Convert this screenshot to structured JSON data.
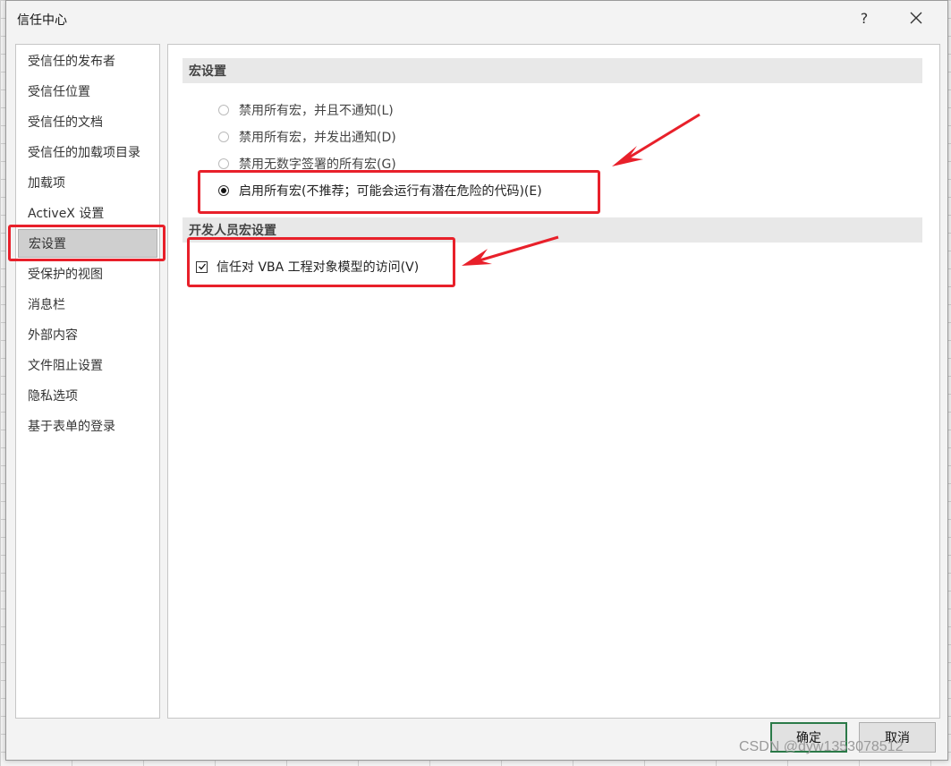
{
  "dialog": {
    "title": "信任中心",
    "help_label": "?"
  },
  "sidebar": {
    "items": [
      {
        "label": "受信任的发布者"
      },
      {
        "label": "受信任位置"
      },
      {
        "label": "受信任的文档"
      },
      {
        "label": "受信任的加载项目录"
      },
      {
        "label": "加载项"
      },
      {
        "label": "ActiveX 设置"
      },
      {
        "label": "宏设置"
      },
      {
        "label": "受保护的视图"
      },
      {
        "label": "消息栏"
      },
      {
        "label": "外部内容"
      },
      {
        "label": "文件阻止设置"
      },
      {
        "label": "隐私选项"
      },
      {
        "label": "基于表单的登录"
      }
    ],
    "selected": "宏设置"
  },
  "macro_settings": {
    "header": "宏设置",
    "options": [
      {
        "label": "禁用所有宏，并且不通知(L)",
        "checked": false
      },
      {
        "label": "禁用所有宏，并发出通知(D)",
        "checked": false
      },
      {
        "label": "禁用无数字签署的所有宏(G)",
        "checked": false
      },
      {
        "label": "启用所有宏(不推荐；可能会运行有潜在危险的代码)(E)",
        "checked": true
      }
    ]
  },
  "developer_settings": {
    "header": "开发人员宏设置",
    "trust_vba_label": "信任对 VBA 工程对象模型的访问(V)",
    "trust_vba_checked": true
  },
  "footer": {
    "ok_label": "确定",
    "cancel_label": "取消"
  },
  "watermark": "CSDN @dyw1353078512",
  "colors": {
    "annotation": "#e8202a",
    "default_button_border": "#2b7a48",
    "selected_item": "#cfcfcf",
    "section_header": "#e8e8e8"
  }
}
